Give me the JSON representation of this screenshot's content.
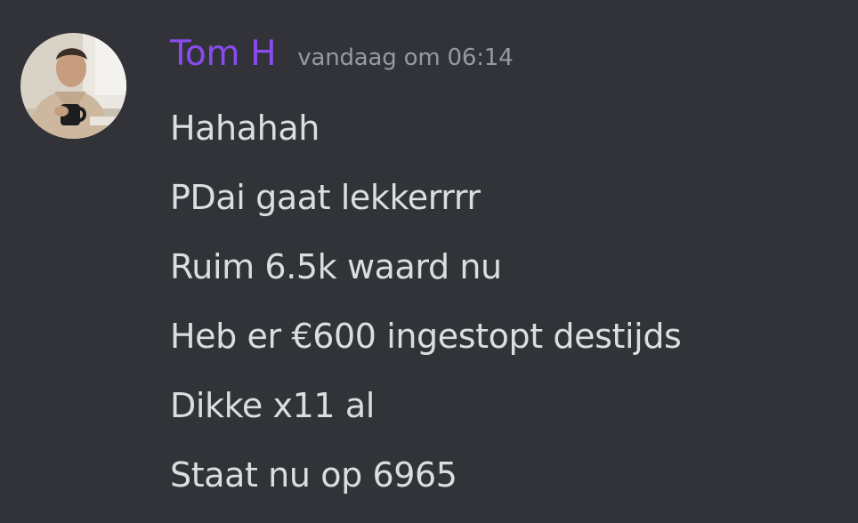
{
  "message": {
    "author": "Tom H",
    "timestamp": "vandaag om 06:14",
    "lines": [
      "Hahahah",
      "PDai gaat lekkerrrr",
      "Ruim 6.5k waard nu",
      "Heb er €600 ingestopt destijds",
      "Dikke x11 al",
      "Staat nu op 6965"
    ]
  },
  "colors": {
    "background": "#313338",
    "username": "#8a4bf0",
    "timestamp": "#969aa2",
    "text": "#dbdee1"
  }
}
